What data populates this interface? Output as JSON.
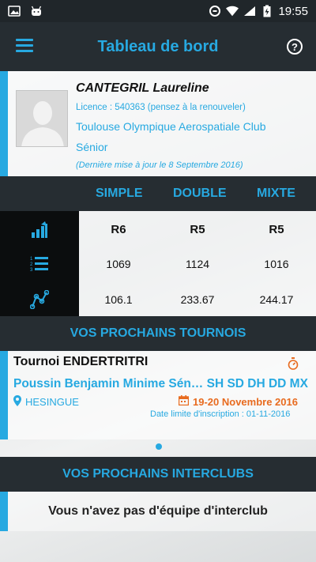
{
  "status_bar": {
    "left_icons": [
      "image-icon",
      "android-icon"
    ],
    "right_icons": [
      "data-saver-icon",
      "wifi-icon",
      "signal-icon",
      "battery-charging-icon"
    ],
    "time": "19:55"
  },
  "app_bar": {
    "title": "Tableau de bord",
    "menu_icon": "hamburger-menu-icon",
    "help_icon": "help-circle-icon",
    "help_glyph": "?"
  },
  "profile": {
    "name": "CANTEGRIL Laureline",
    "licence": "Licence : 540363 (pensez à la renouveler)",
    "club": "Toulouse Olympique Aerospatiale Club",
    "category": "Sénior",
    "last_update": "(Dernière mise à jour le 8 Septembre 2016)"
  },
  "rankings": {
    "headers": [
      "SIMPLE",
      "DOUBLE",
      "MIXTE"
    ],
    "rows": [
      {
        "icon": "progression-chart-icon",
        "values": [
          "R6",
          "R5",
          "R5"
        ]
      },
      {
        "icon": "ranked-list-icon",
        "values": [
          "1069",
          "1124",
          "1016"
        ]
      },
      {
        "icon": "points-graph-icon",
        "values": [
          "106.1",
          "233.67",
          "244.17"
        ]
      }
    ]
  },
  "tournaments": {
    "section_title": "VOS PROCHAINS TOURNOIS",
    "items": [
      {
        "name": "Tournoi ENDERTRITRI",
        "categories": "Poussin Benjamin Minime Sén… SH SD DH DD MX",
        "location": "HESINGUE",
        "dates": "19-20 Novembre 2016",
        "deadline": "Date limite d'inscription : 01-11-2016"
      }
    ]
  },
  "interclubs": {
    "section_title": "VOS PROCHAINS INTERCLUBS",
    "message": "Vous n'avez pas d'équipe d'interclub"
  },
  "colors": {
    "accent": "#27a9e1",
    "dark_bar": "#262d32",
    "date_orange": "#e86b1f"
  }
}
